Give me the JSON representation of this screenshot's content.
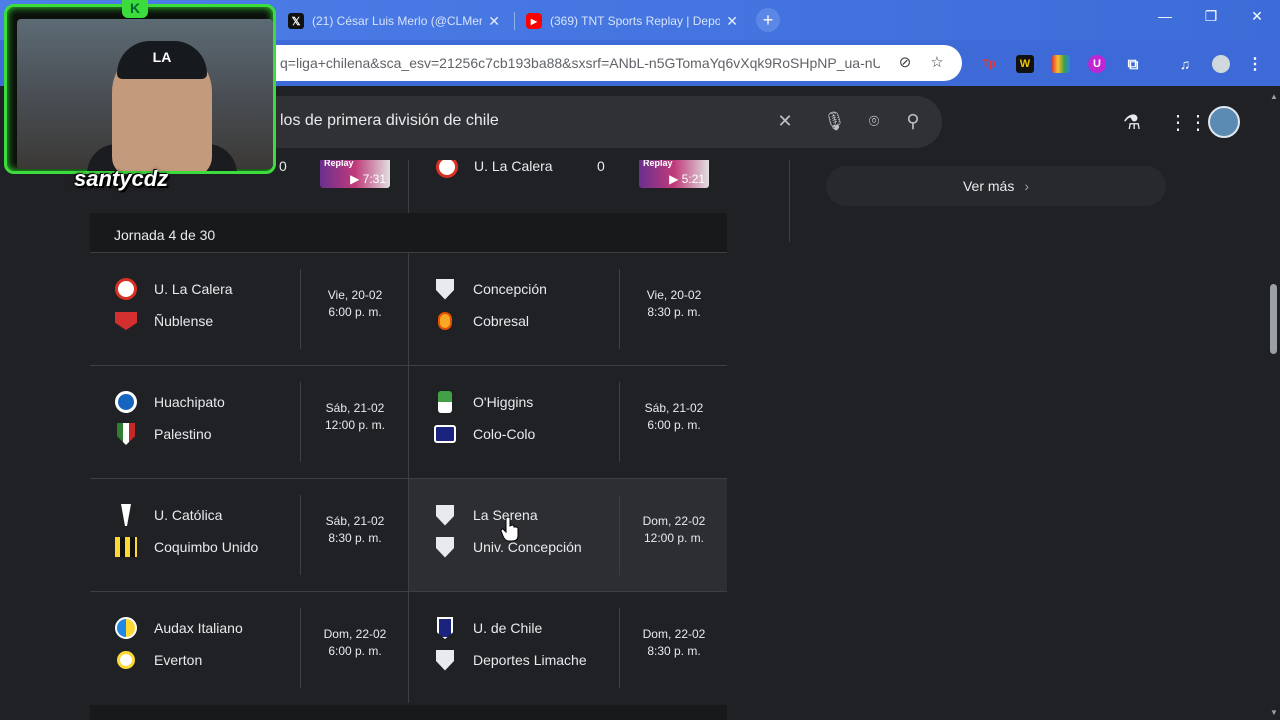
{
  "browser": {
    "tabs": [
      {
        "title": "(21) César Luis Merlo (@CLMerl",
        "favicon": "X"
      },
      {
        "title": "(369) TNT Sports Replay | Depo",
        "favicon": "youtube"
      }
    ],
    "new_tab": "+",
    "url": "q=liga+chilena&sca_esv=21256c7cb193ba88&sxsrf=ANbL-n5GTomaYq6vXqk9RoSHpNP_ua-nU...",
    "extensions": [
      "Tp",
      "W",
      "colors",
      "U",
      "puzzle",
      "media"
    ]
  },
  "search": {
    "query": "los de primera división de chile"
  },
  "webcam": {
    "name": "santycdz",
    "cap_text": "LA",
    "badge": "K"
  },
  "previous_row": {
    "left_score": "0",
    "left_video_duration": "7:31",
    "right_team": "U. La Calera",
    "right_score": "0",
    "right_video_duration": "5:21",
    "replay_label": "Replay"
  },
  "jornada": {
    "label": "Jornada 4 de 30",
    "matches": [
      {
        "home": "U. La Calera",
        "away": "Ñublense",
        "date": "Vie, 20-02",
        "time": "6:00 p. m."
      },
      {
        "home": "Concepción",
        "away": "Cobresal",
        "date": "Vie, 20-02",
        "time": "8:30 p. m."
      },
      {
        "home": "Huachipato",
        "away": "Palestino",
        "date": "Sáb, 21-02",
        "time": "12:00 p. m."
      },
      {
        "home": "O'Higgins",
        "away": "Colo-Colo",
        "date": "Sáb, 21-02",
        "time": "6:00 p. m."
      },
      {
        "home": "U. Católica",
        "away": "Coquimbo Unido",
        "date": "Sáb, 21-02",
        "time": "8:30 p. m."
      },
      {
        "home": "La Serena",
        "away": "Univ. Concepción",
        "date": "Dom, 22-02",
        "time": "12:00 p. m."
      },
      {
        "home": "Audax Italiano",
        "away": "Everton",
        "date": "Dom, 22-02",
        "time": "6:00 p. m."
      },
      {
        "home": "U. de Chile",
        "away": "Deportes Limache",
        "date": "Dom, 22-02",
        "time": "8:30 p. m."
      }
    ]
  },
  "sidebar": {
    "ver_mas": "Ver más"
  },
  "colors": {
    "background": "#202124",
    "tabbar": "#3d6cd8",
    "webcam_frame": "#3ddc3d"
  }
}
